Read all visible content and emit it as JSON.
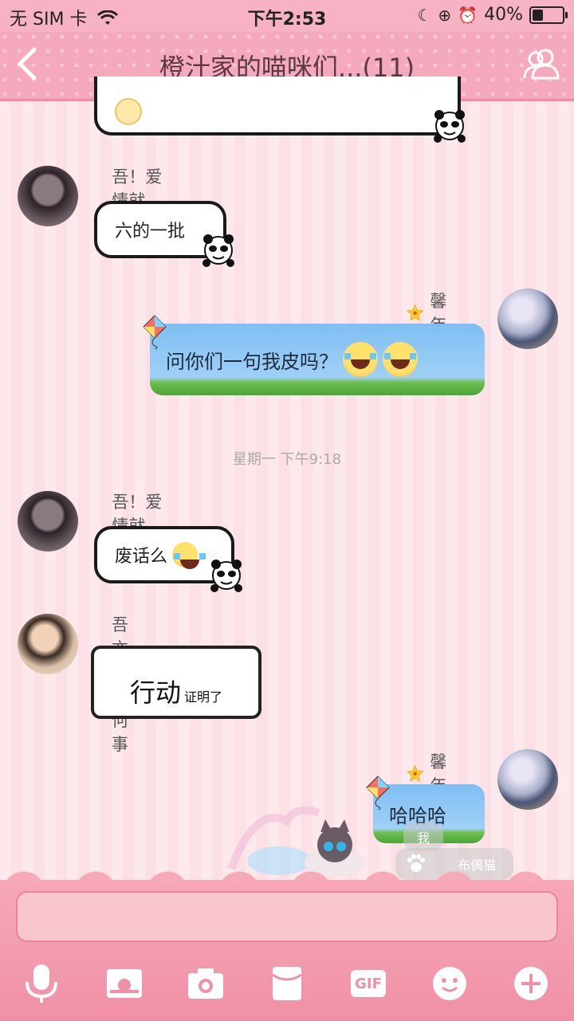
{
  "status_bar": {
    "carrier": "无 SIM 卡",
    "time": "下午2:53",
    "battery": "40%",
    "battery_level": 0.4
  },
  "header": {
    "title": "橙汁家的喵咪们...(11)"
  },
  "messages": [
    {
      "sender": "吾！爱情就是“扯蛋”™",
      "text": "六的一批"
    },
    {
      "sender": "馨年",
      "text": "问你们一句我皮吗？"
    },
    {
      "sender": "吾！爱情就是“扯蛋”™",
      "text": "废话么"
    },
    {
      "sender": "吾亦干卿何事",
      "text_main": "行动",
      "text_small": "证明了"
    },
    {
      "sender": "馨年",
      "text": "哈哈哈"
    }
  ],
  "timestamp": "星期一 下午9:18",
  "overlay_tags": {
    "me": "我",
    "pet_name": "布偶猫"
  },
  "toolbar": {
    "items": [
      "mic-icon",
      "image-icon",
      "camera-icon",
      "red-packet-icon",
      "gif-icon",
      "emoji-icon",
      "plus-icon"
    ],
    "gif_label": "GIF"
  },
  "colors": {
    "header_bg": "#f5a9bd",
    "toolbar_bg": "#f090a6",
    "accent": "#f08aa7"
  }
}
